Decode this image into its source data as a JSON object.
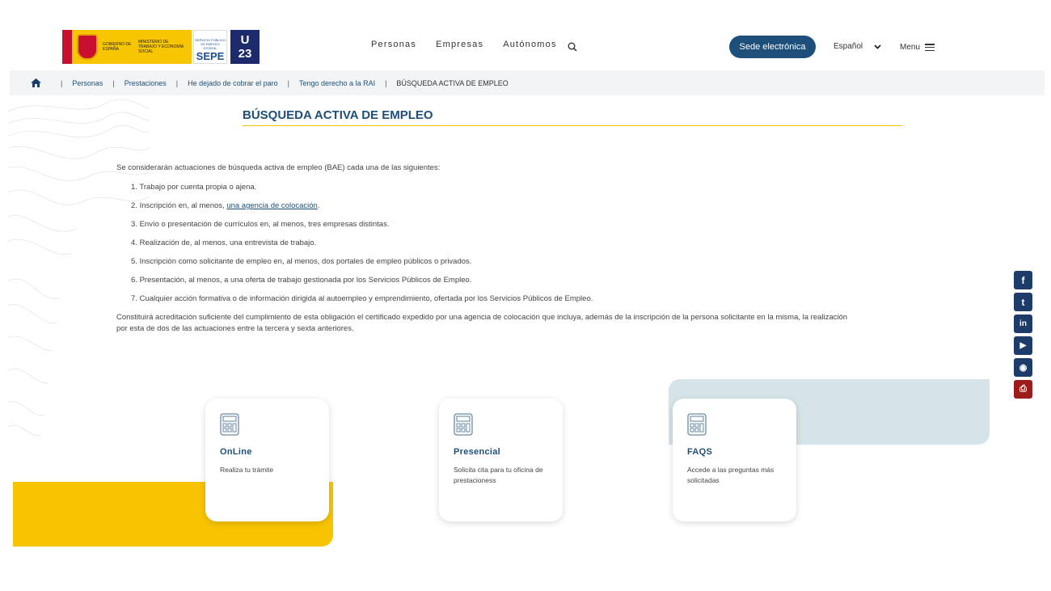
{
  "header": {
    "logo": {
      "gov_text": "GOBIERNO DE ESPAÑA",
      "ministry_text": "MINISTERIO DE TRABAJO Y ECONOMÍA SOCIAL",
      "sepe_small": "SERVICIO PÚBLICO DE EMPLEO ESTATAL",
      "sepe_text": "SEPE",
      "u23_line1": "U",
      "u23_line2": "23"
    },
    "nav": [
      "Personas",
      "Empresas",
      "Autónomos"
    ],
    "sede_label": "Sede electrónica",
    "language": "Español",
    "menu_label": "Menu"
  },
  "breadcrumb": {
    "items": [
      "Personas",
      "Prestaciones",
      "He dejado de cobrar el paro",
      "Tengo derecho a la RAI"
    ],
    "current": "BÚSQUEDA ACTIVA DE EMPLEO"
  },
  "main": {
    "title": "BÚSQUEDA ACTIVA DE EMPLEO",
    "intro": "Se considerarán actuaciones de búsqueda activa de empleo (BAE) cada una de las siguientes:",
    "list": [
      {
        "num": "1.",
        "text": "Trabajo por cuenta propia o ajena."
      },
      {
        "num": "2.",
        "pre": "Inscripción en, al menos, ",
        "link": "una agencia de colocación",
        "post": "."
      },
      {
        "num": "3.",
        "text": "Envío o presentación de currículos en, al menos, tres empresas distintas."
      },
      {
        "num": "4.",
        "text": "Realización de, al menos, una entrevista de trabajo."
      },
      {
        "num": "5.",
        "text": "Inscripción como solicitante de empleo en, al menos, dos portales de empleo públicos o privados."
      },
      {
        "num": "6.",
        "text": "Presentación, al menos, a una oferta de trabajo gestionada por los Servicios Públicos de Empleo."
      },
      {
        "num": "7.",
        "text": "Cualquier acción formativa o de información dirigida al autoempleo y emprendimiento, ofertada por los Servicios Públicos de Empleo."
      }
    ],
    "closing": "Constituirá acreditación suficiente del cumplimiento de esta obligación el certificado expedido por una agencia de colocación que incluya, además de la inscripción de la persona solicitante en la misma, la realización por esta de dos de las actuaciones entre la tercera y sexta anteriores."
  },
  "cards": [
    {
      "title": "OnLine",
      "desc": "Realiza tu trámite"
    },
    {
      "title": "Presencial",
      "desc": "Solicita cita para tu oficina de prestacioness"
    },
    {
      "title": "FAQS",
      "desc": "Accede a las preguntas más solicitadas"
    }
  ],
  "social": {
    "icons": [
      "facebook-icon",
      "twitter-icon",
      "linkedin-icon",
      "youtube-icon",
      "rss-icon",
      "pdf-icon"
    ],
    "glyphs": [
      "f",
      "t",
      "in",
      "▶",
      "◉",
      "⎙"
    ]
  },
  "colors": {
    "brand_blue": "#1d4f7a",
    "accent_yellow": "#f8c300",
    "light_blue": "#d5e4e8",
    "pdf_red": "#9c1b1b"
  }
}
